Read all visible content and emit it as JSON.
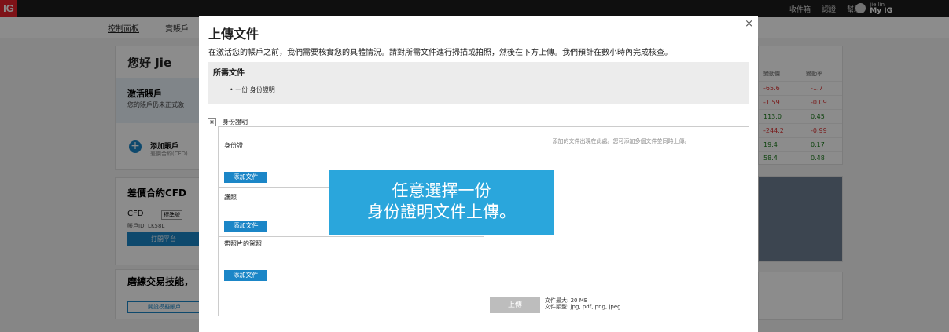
{
  "topbar": {
    "logo": "IG",
    "links": [
      "收件箱",
      "認證",
      "幫助"
    ],
    "user_name": "jie lin",
    "user_label": "My IG"
  },
  "subnav": {
    "tabs": [
      "控制面板",
      "賞賬戶"
    ]
  },
  "background": {
    "greeting": "您好 Jie",
    "activate_title": "激活賬戶",
    "activate_text": "您的賬戶仍未正式激",
    "add_account_title": "添加賬戶",
    "add_account_sub": "差價合約(CFD)",
    "cfd_section_title": "差價合約CFD",
    "cfd_account_label": "CFD",
    "cfd_tag": "標準號",
    "account_id": "賬戶ID: LK58L",
    "open_platform": "打開平台",
    "practice_title": "磨練交易技能，",
    "open_demo": "開設模擬賬戶",
    "market_headers": [
      "變動價",
      "變動率"
    ],
    "market_rows": [
      [
        "-65.6",
        "-1.7"
      ],
      [
        "-1.59",
        "-0.09"
      ],
      [
        "113.0",
        "0.45"
      ],
      [
        "-244.2",
        "-0.99"
      ],
      [
        "19.4",
        "0.17"
      ],
      [
        "58.4",
        "0.48"
      ]
    ]
  },
  "modal": {
    "title": "上傳文件",
    "close": "×",
    "description": "在激活您的帳戶之前，我們需要核實您的具體情況。請對所需文件進行掃描或拍照，然後在下方上傳。我們預計在數小時內完成核查。",
    "required_title": "所需文件",
    "required_item": "一份 身份證明",
    "section_label": "身份證明",
    "documents": [
      {
        "label": "身份證",
        "button": "添加文件"
      },
      {
        "label": "護照",
        "button": "添加文件"
      },
      {
        "label": "帶照片的駕照",
        "button": "添加文件"
      }
    ],
    "right_hint": "添加的文件出現在此處。您可添加多個文件並同時上傳。",
    "upload_button": "上傳",
    "max_size": "文件最大: 20 MB",
    "file_types": "文件類型: jpg, pdf, png, jpeg"
  },
  "callout": {
    "line1": "任意選擇一份",
    "line2": "身份證明文件上傳。"
  }
}
